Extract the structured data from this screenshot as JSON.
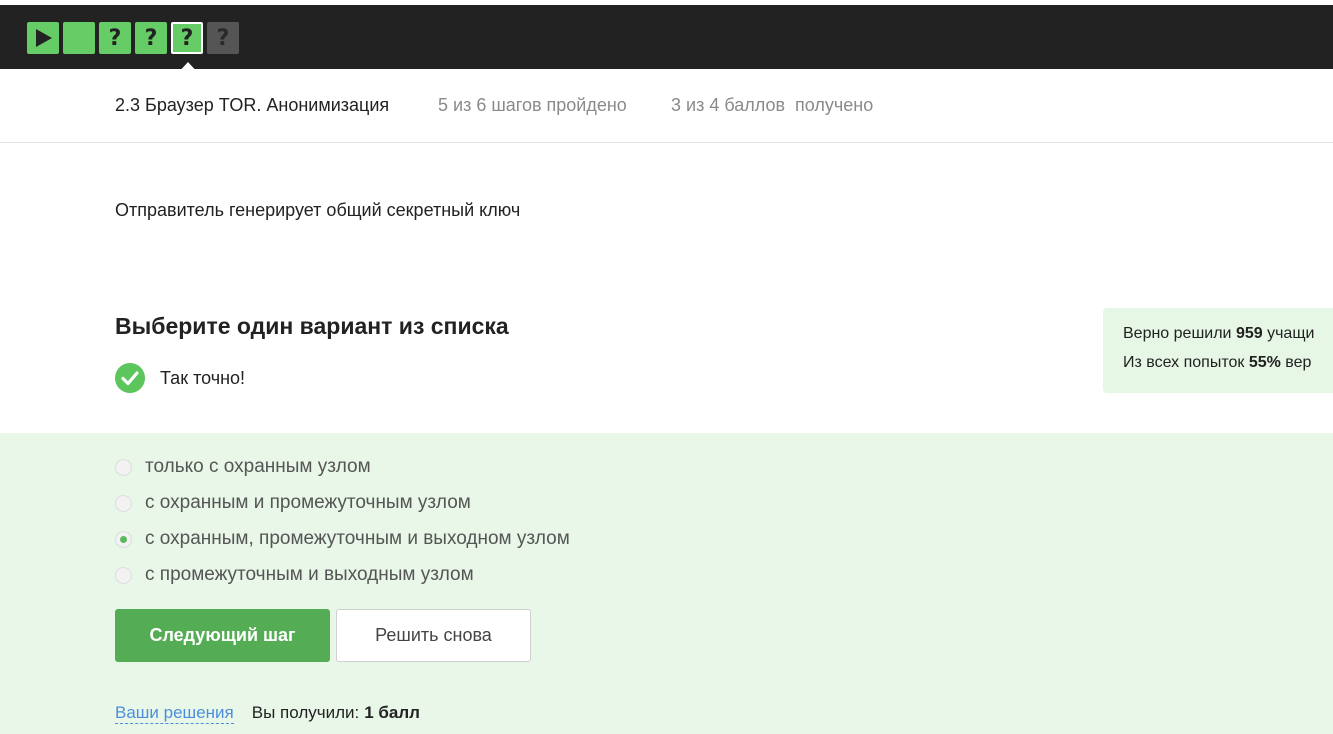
{
  "steps": [
    {
      "glyph": "▶",
      "state": "done",
      "icon": "play-icon"
    },
    {
      "glyph": "",
      "state": "done",
      "icon": "blank-step"
    },
    {
      "glyph": "?",
      "state": "done",
      "icon": "question-icon"
    },
    {
      "glyph": "?",
      "state": "done",
      "icon": "question-icon"
    },
    {
      "glyph": "?",
      "state": "current",
      "icon": "question-icon"
    },
    {
      "glyph": "?",
      "state": "pending",
      "icon": "question-icon"
    }
  ],
  "lesson": {
    "title": "2.3 Браузер TOR. Анонимизация",
    "steps_progress": "5 из 6 шагов пройдено",
    "points_progress": "3 из 4 баллов  получено"
  },
  "question": {
    "text": "Отправитель генерирует общий секретный ключ"
  },
  "task": {
    "title": "Выберите один вариант из списка",
    "result": "Так точно!"
  },
  "stats": {
    "line1_prefix": "Верно решили ",
    "line1_value": "959",
    "line1_suffix": " учащи",
    "line2_prefix": "Из всех попыток ",
    "line2_value": "55%",
    "line2_suffix": " вер"
  },
  "options": [
    {
      "label": "только с охранным узлом",
      "checked": false
    },
    {
      "label": "с охранным и промежуточным узлом",
      "checked": false
    },
    {
      "label": "с охранным, промежуточным и выходном узлом",
      "checked": true
    },
    {
      "label": "с промежуточным и выходным узлом",
      "checked": false
    }
  ],
  "buttons": {
    "next": "Следующий шаг",
    "retry": "Решить снова"
  },
  "footer": {
    "solutions_link": "Ваши решения",
    "got_label": "Вы получили:",
    "got_value": "1 балл"
  },
  "colors": {
    "topbar": "#222222",
    "step_green": "#66cc66",
    "step_grey": "#555555",
    "accent_green": "#54ad54",
    "zone_green": "#e8f7e8",
    "link_blue": "#4d8fdc"
  }
}
